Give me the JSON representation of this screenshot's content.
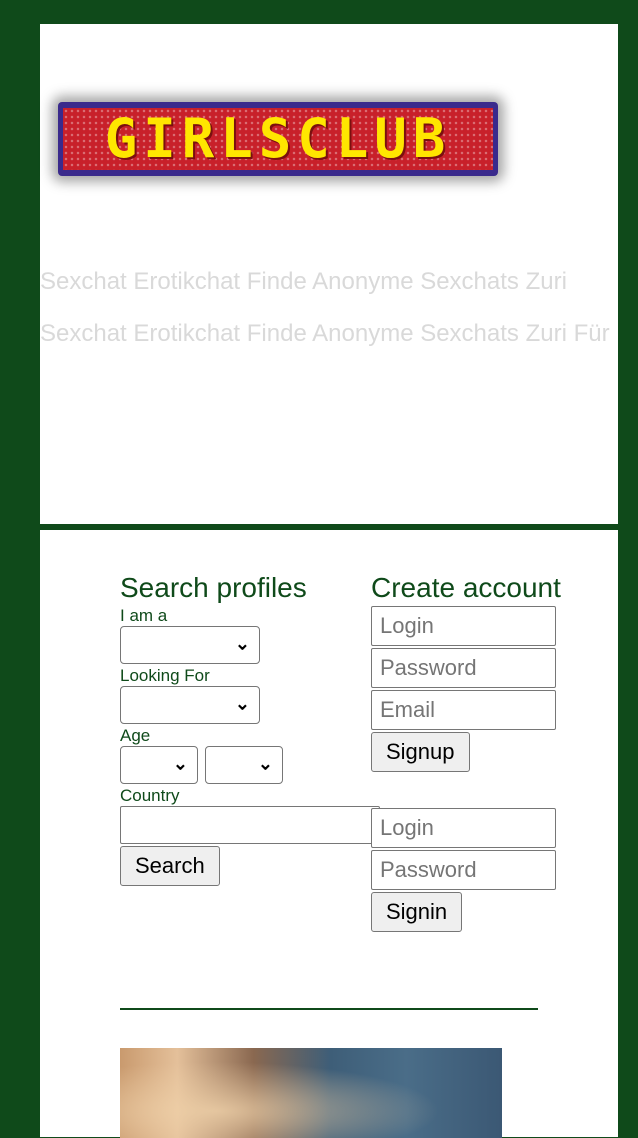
{
  "logo": {
    "text": "GIRLSCLUB"
  },
  "tagline": {
    "line1": "Sexchat Erotikchat Finde Anonyme Sexchats Zuri",
    "line2": "Sexchat Erotikchat Finde Anonyme Sexchats Zuri Für"
  },
  "search": {
    "heading": "Search profiles",
    "i_am_label": "I am a",
    "i_am_value": "",
    "looking_for_label": "Looking For",
    "looking_for_value": "",
    "age_label": "Age",
    "age_from": "",
    "age_to": "",
    "country_label": "Country",
    "country_value": "",
    "button": "Search"
  },
  "signup": {
    "heading": "Create account",
    "login_placeholder": "Login",
    "password_placeholder": "Password",
    "email_placeholder": "Email",
    "button": "Signup"
  },
  "signin": {
    "login_placeholder": "Login",
    "password_placeholder": "Password",
    "button": "Signin"
  },
  "colors": {
    "brand_green": "#0f4a1a",
    "background": "#ffffff",
    "tagline_gray": "#d9d9d9",
    "logo_red": "#c8202a",
    "logo_yellow": "#ffe600"
  }
}
